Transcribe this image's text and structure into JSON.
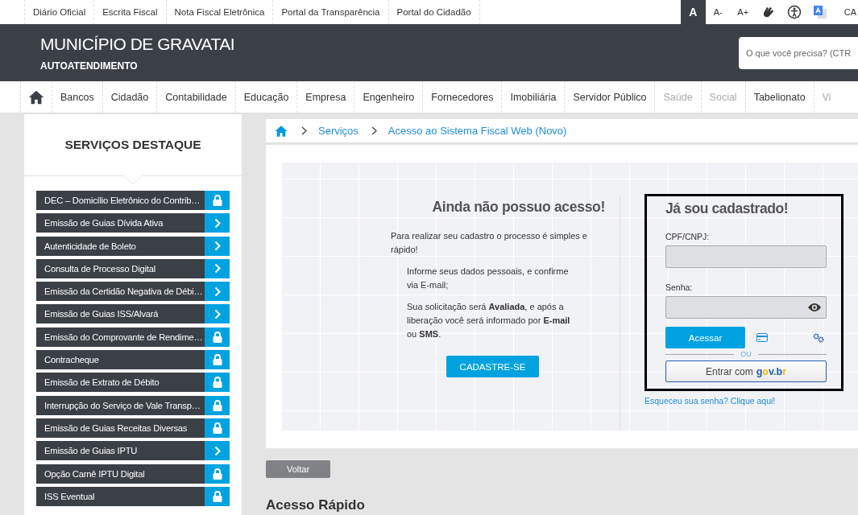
{
  "top_links": [
    "Diário Oficial",
    "Escrita Fiscal",
    "Nota Fiscal Eletrônica",
    "Portal da Transparência",
    "Portal do Cidadão"
  ],
  "font_controls": [
    {
      "label": "A",
      "selected": true
    },
    {
      "label": "A-",
      "selected": false
    },
    {
      "label": "A+",
      "selected": false
    }
  ],
  "top_right_text": "CA",
  "header": {
    "title": "MUNICÍPIO DE GRAVATAI",
    "subtitle": "AUTOATENDIMENTO",
    "search": {
      "placeholder": "O que você precisa? (CTR"
    }
  },
  "nav": [
    {
      "label": "Bancos",
      "disabled": false
    },
    {
      "label": "Cidadão",
      "disabled": false
    },
    {
      "label": "Contabilidade",
      "disabled": false
    },
    {
      "label": "Educação",
      "disabled": false
    },
    {
      "label": "Empresa",
      "disabled": false
    },
    {
      "label": "Engenheiro",
      "disabled": false
    },
    {
      "label": "Fornecedores",
      "disabled": false
    },
    {
      "label": "Imobiliária",
      "disabled": false
    },
    {
      "label": "Servidor Público",
      "disabled": false
    },
    {
      "label": "Saúde",
      "disabled": true
    },
    {
      "label": "Social",
      "disabled": true
    },
    {
      "label": "Tabelionato",
      "disabled": false
    },
    {
      "label": "Vi",
      "disabled": true
    }
  ],
  "sidebar": {
    "title": "SERVIÇOS DESTAQUE",
    "items": [
      {
        "label": "DEC – Domicílio Eletrônico do Contrib…",
        "kind": "lock"
      },
      {
        "label": "Emissão de Guias Dívida Ativa",
        "kind": "arrow"
      },
      {
        "label": "Autenticidade de Boleto",
        "kind": "arrow"
      },
      {
        "label": "Consulta de Processo Digital",
        "kind": "arrow"
      },
      {
        "label": "Emissão da Certidão Negativa de Débi…",
        "kind": "arrow"
      },
      {
        "label": "Emissão de Guias ISS/Alvará",
        "kind": "arrow"
      },
      {
        "label": "Emissão do Comprovante de Rendime…",
        "kind": "lock"
      },
      {
        "label": "Contracheque",
        "kind": "lock"
      },
      {
        "label": "Emissão de Extrato de Débito",
        "kind": "lock"
      },
      {
        "label": "Interrupção do Serviço de Vale Transp…",
        "kind": "lock"
      },
      {
        "label": "Emissão de Guias Receitas Diversas",
        "kind": "lock"
      },
      {
        "label": "Emissão de Guias IPTU",
        "kind": "arrow"
      },
      {
        "label": "Opção Carnê IPTU Digital",
        "kind": "lock"
      },
      {
        "label": "ISS Eventual",
        "kind": "lock"
      }
    ]
  },
  "breadcrumb": [
    "Serviços",
    "Acesso ao Sistema Fiscal Web (Novo)"
  ],
  "register": {
    "title": "Ainda não possuo acesso!",
    "intro": "Para realizar seu cadastro o processo é simples e rápido!",
    "steps": [
      "Informe seus dados pessoais, e confirme via E-mail;",
      "Sua solicitação será **Avaliada**, e após a liberação você será informado por **E-mail** ou **SMS**."
    ],
    "button": "CADASTRE-SE"
  },
  "login": {
    "title": "Já sou cadastrado!",
    "user_label": "CPF/CNPJ:",
    "password_label": "Senha:",
    "submit": "Acessar",
    "separator": "OU",
    "govbr_prefix": "Entrar com",
    "govbr_logo": "gov.br",
    "forgot": "Esqueceu sua senha? Clique aqui!"
  },
  "back_button": "Voltar",
  "quick_access": {
    "title": "Acesso Rápido"
  }
}
